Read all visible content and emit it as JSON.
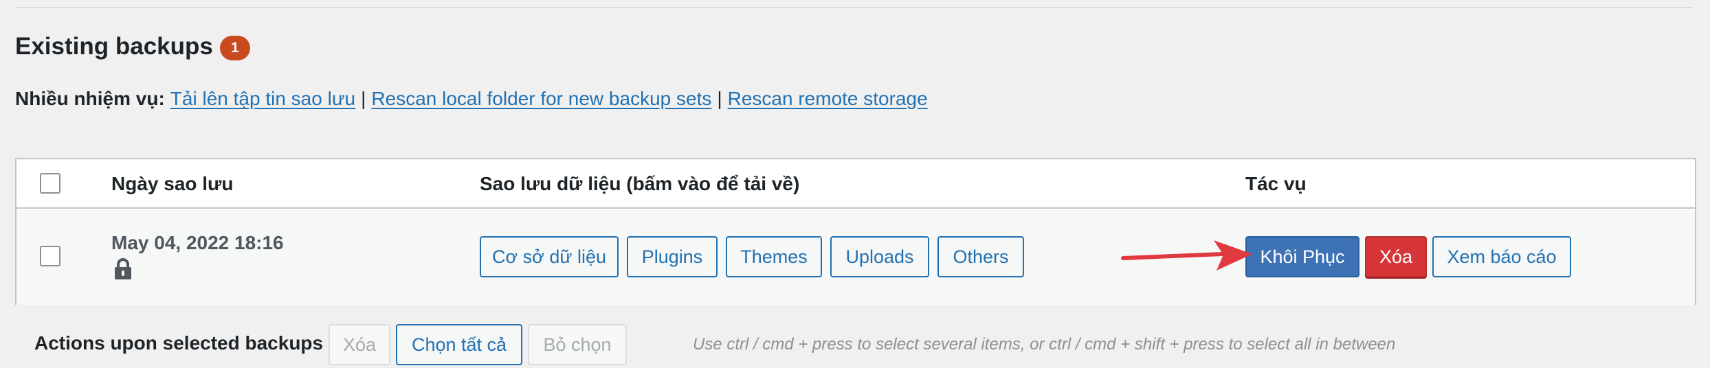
{
  "heading": {
    "title": "Existing backups",
    "count": "1"
  },
  "tasks": {
    "label": "Nhiều nhiệm vụ:",
    "links": [
      "Tải lên tập tin sao lưu",
      "Rescan local folder for new backup sets",
      "Rescan remote storage"
    ],
    "separator": "|"
  },
  "table": {
    "columns": [
      "Ngày sao lưu",
      "Sao lưu dữ liệu (bấm vào để tải về)",
      "Tác vụ"
    ],
    "rows": [
      {
        "date": "May 04, 2022 18:16",
        "locked": true,
        "data_buttons": [
          "Cơ sở dữ liệu",
          "Plugins",
          "Themes",
          "Uploads",
          "Others"
        ],
        "actions": {
          "restore": "Khôi Phục",
          "delete": "Xóa",
          "view_log": "Xem báo cáo"
        }
      }
    ]
  },
  "bulk_actions": {
    "label": "Actions upon selected backups",
    "delete": "Xóa",
    "select_all": "Chọn tất cả",
    "deselect": "Bỏ chọn",
    "hint": "Use ctrl / cmd + press to select several items, or ctrl / cmd + shift + press to select all in between"
  },
  "colors": {
    "link": "#2271b1",
    "badge": "#ca4a1f",
    "primary": "#3d72b4",
    "danger": "#d63638",
    "annotation_arrow": "#e0393e"
  },
  "icons": {
    "lock": "lock-icon",
    "arrow": "annotation-arrow"
  }
}
